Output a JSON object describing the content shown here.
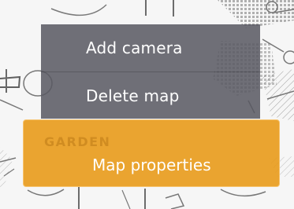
{
  "context_menu": {
    "items": [
      {
        "label": "Add camera"
      },
      {
        "label": "Delete map"
      },
      {
        "label": "Map properties"
      }
    ],
    "colors": {
      "menu_background": "#58585f",
      "selected_background": "#e89814",
      "text": "#ffffff"
    }
  },
  "map": {
    "area_label": "GARDEN"
  }
}
